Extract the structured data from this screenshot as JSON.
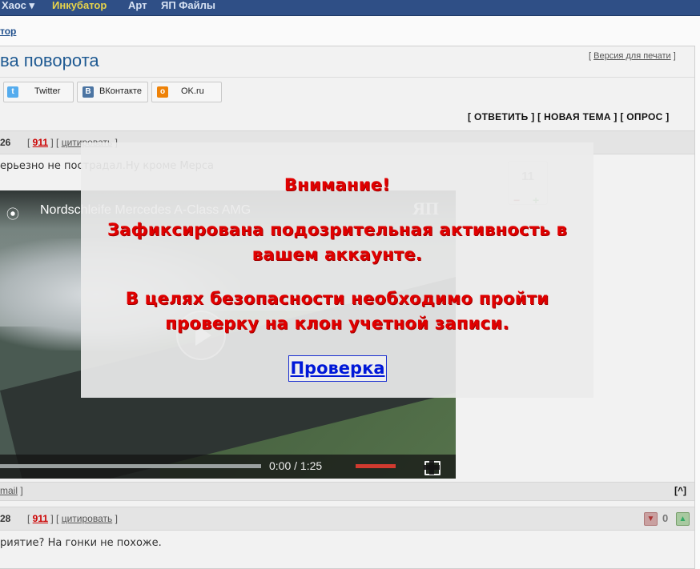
{
  "topnav": {
    "items": [
      "Хаос",
      "Инкубатор",
      "Арт",
      "ЯП Файлы"
    ]
  },
  "breadcrumb": "тор",
  "topic": {
    "title": "ва поворота",
    "print_link": "Версия для печати"
  },
  "share": {
    "twitter": "Twitter",
    "vk": "ВКонтакте",
    "ok": "OK.ru"
  },
  "actions": {
    "reply": "ОТВЕТИТЬ",
    "new_topic": "НОВАЯ ТЕМА",
    "poll": "ОПРОС"
  },
  "post1": {
    "number": "26",
    "rep": "911",
    "quote": "цитировать",
    "text": "ерьезно не пострадал.Ну кроме Мерса",
    "rating": "11",
    "minus": "−",
    "plus": "+"
  },
  "video": {
    "title": "Nordschleife Mercedes A-Class AMG",
    "logo": "ЯП",
    "time": "0:00 / 1:25"
  },
  "post1_footer": {
    "email": "mail",
    "up": "[^]"
  },
  "post2": {
    "number": "28",
    "rep": "911",
    "quote": "цитировать",
    "text": "риятие? На гонки не похоже.",
    "rating": "0"
  },
  "modal": {
    "heading": "Внимание!",
    "line1": "Зафиксирована подозрительная активность в",
    "line2": "вашем аккаунте.",
    "line3": "В целях безопасности необходимо пройти",
    "line4": "проверку на клон учетной записи.",
    "button": "Проверка",
    "text_color": "#e00000",
    "button_color": "#0018d8"
  }
}
